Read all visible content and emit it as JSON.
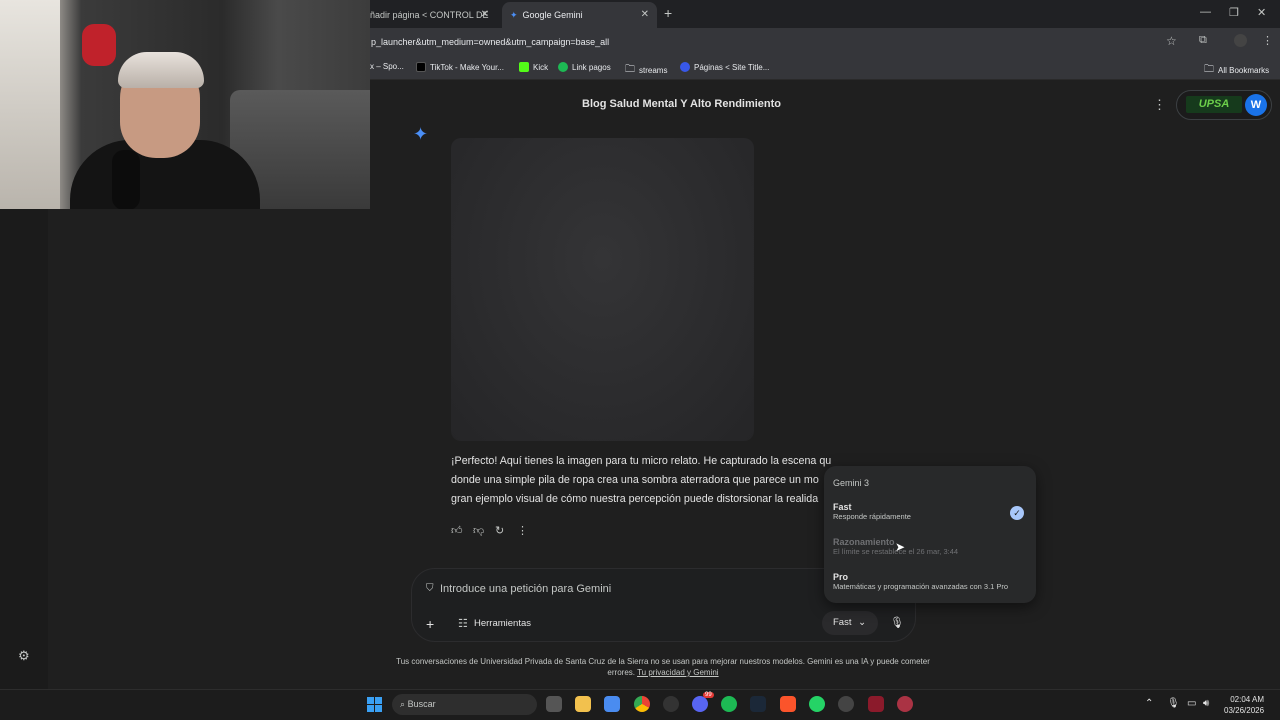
{
  "browser": {
    "tabs": [
      {
        "title": "ñadir página < CONTROL DE"
      },
      {
        "title": "Google Gemini"
      }
    ],
    "url": "p_launcher&utm_medium=owned&utm_campaign=base_all",
    "bookmarks": [
      "x – Spo...",
      "TikTok - Make Your...",
      "Kick",
      "Link pagos",
      "streams",
      "Páginas < Site Title..."
    ],
    "all_bookmarks": "All Bookmarks"
  },
  "gemini": {
    "conversation_title": "Blog Salud Mental Y Alto Rendimiento",
    "account_badge": "UPSA",
    "avatar_letter": "W",
    "response_lines": [
      "¡Perfecto! Aquí tienes la imagen para tu micro relato. He capturado la escena que describiste,",
      "donde una simple pila de ropa crea una sombra aterradora que parece un mo",
      "gran ejemplo visual de cómo nuestra percepción puede distorsionar la realida"
    ],
    "input_placeholder": "Introduce una petición para Gemini",
    "tools_label": "Herramientas",
    "model_button": "Fast",
    "model_menu": {
      "header": "Gemini 3",
      "options": [
        {
          "title": "Fast",
          "desc": "Responde rápidamente",
          "selected": true,
          "disabled": false
        },
        {
          "title": "Razonamiento",
          "desc": "El límite se restablece el 26 mar, 3:44",
          "selected": false,
          "disabled": true
        },
        {
          "title": "Pro",
          "desc": "Matemáticas y programación avanzadas con 3.1 Pro",
          "selected": false,
          "disabled": false
        }
      ]
    },
    "disclaimer_line1": "Tus conversaciones de Universidad Privada de Santa Cruz de la Sierra no se usan para mejorar nuestros modelos. Gemini es una IA y puede cometer",
    "disclaimer_line2_prefix": "errores.",
    "disclaimer_link": "Tu privacidad y Gemini"
  },
  "taskbar": {
    "search_placeholder": "Buscar",
    "time": "02:04 AM",
    "date": "03/26/2026",
    "discord_badge": "99"
  }
}
